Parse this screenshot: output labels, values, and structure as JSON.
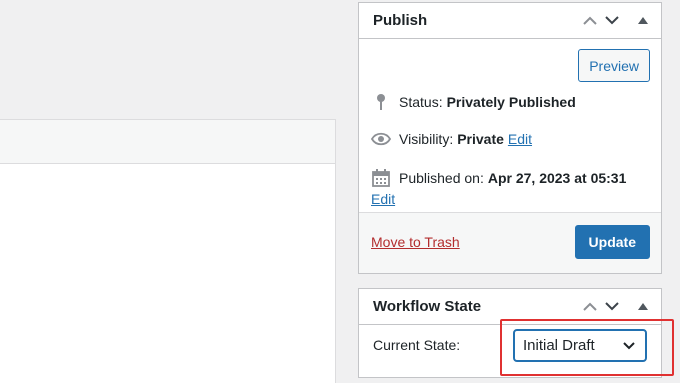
{
  "publish": {
    "title": "Publish",
    "preview_label": "Preview",
    "status_label": "Status:",
    "status_value": "Privately Published",
    "visibility_label": "Visibility:",
    "visibility_value": "Private",
    "visibility_edit": "Edit",
    "published_label": "Published on:",
    "published_value": "Apr 27, 2023 at 05:31",
    "published_edit": "Edit",
    "trash_label": "Move to Trash",
    "update_label": "Update"
  },
  "workflow": {
    "title": "Workflow State",
    "current_state_label": "Current State:",
    "current_state_value": "Initial Draft"
  },
  "icons": {
    "pin": "pin-icon",
    "eye": "eye-icon",
    "calendar": "calendar-icon",
    "move_up": "chevron-up-icon",
    "move_down": "chevron-down-icon",
    "toggle": "triangle-up-icon"
  },
  "colors": {
    "accent": "#2271b1",
    "danger": "#b32d2e",
    "highlight": "#e03131"
  }
}
